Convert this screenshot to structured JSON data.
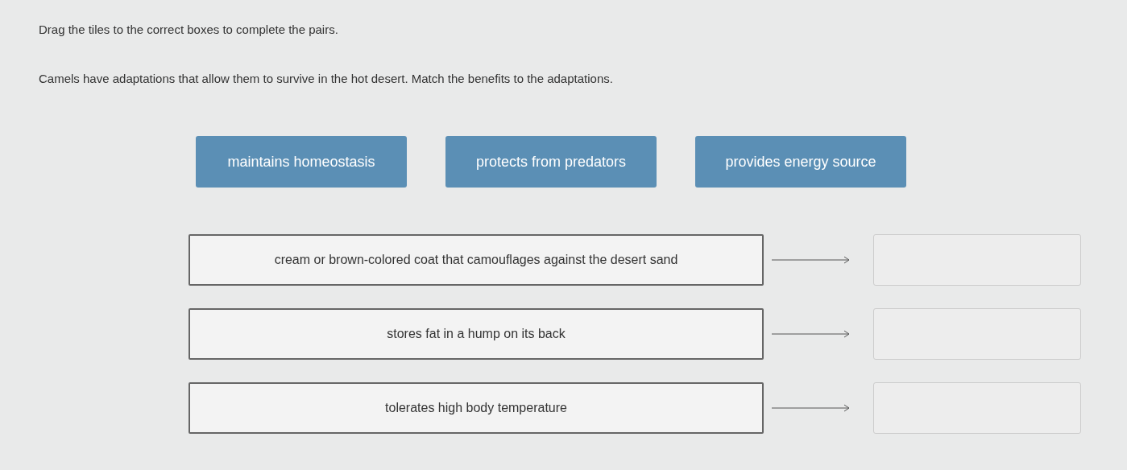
{
  "instruction": "Drag the tiles to the correct boxes to complete the pairs.",
  "question": "Camels have adaptations that allow them to survive in the hot desert. Match the benefits to the adaptations.",
  "tiles": [
    "maintains homeostasis",
    "protects from predators",
    "provides energy source"
  ],
  "pairs": [
    {
      "adaptation": "cream or brown-colored coat that camouflages against the desert sand"
    },
    {
      "adaptation": "stores fat in a hump on its back"
    },
    {
      "adaptation": "tolerates high body temperature"
    }
  ]
}
